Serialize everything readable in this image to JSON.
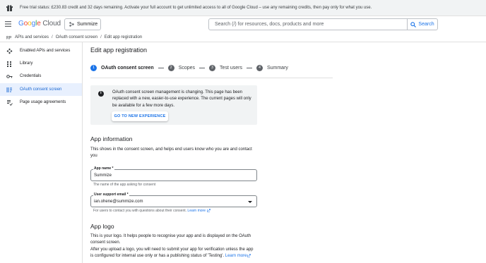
{
  "banner": {
    "text": "Free trial status: £230.83 credit and 32 days remaining. Activate your full account to get unlimited access to all of Google Cloud – use any remaining credits, then pay only for what you use."
  },
  "header": {
    "logo_google": "Google",
    "logo_cloud": "Cloud",
    "project": "Summize",
    "search_placeholder": "Search (/) for resources, docs, products and more",
    "search_button": "Search"
  },
  "breadcrumb": [
    "APIs and services",
    "OAuth consent screen",
    "Edit app registration"
  ],
  "sidebar": {
    "items": [
      {
        "label": "Enabled APIs and services",
        "icon": "apis-icon",
        "active": false
      },
      {
        "label": "Library",
        "icon": "library-icon",
        "active": false
      },
      {
        "label": "Credentials",
        "icon": "key-icon",
        "active": false
      },
      {
        "label": "OAuth consent screen",
        "icon": "consent-icon",
        "active": true
      },
      {
        "label": "Page usage agreements",
        "icon": "agreements-icon",
        "active": false
      }
    ]
  },
  "main": {
    "title": "Edit app registration",
    "steps": [
      {
        "num": "1",
        "label": "OAuth consent screen",
        "active": true
      },
      {
        "num": "2",
        "label": "Scopes",
        "active": false
      },
      {
        "num": "3",
        "label": "Test users",
        "active": false
      },
      {
        "num": "4",
        "label": "Summary",
        "active": false
      }
    ],
    "notice": {
      "line1": "OAuth consent screen management is changing. This page has been",
      "line2": "replaced with a new, easier-to-use experience. The current pages will only",
      "line3": "be available for a few more days.",
      "button": "GO TO NEW EXPERIENCE"
    },
    "app_info": {
      "heading": "App information",
      "desc_line1": "This shows in the consent screen, and helps end users know who you are and contact",
      "desc_line2": "you",
      "app_name_label": "App name *",
      "app_name_value": "Summize",
      "app_name_hint": "The name of the app asking for consent",
      "support_email_label": "User support email *",
      "support_email_value": "ian.ohene@summize.com",
      "support_email_hint": "For users to contact you with questions about their consent.",
      "learn_more": "Learn more"
    },
    "app_logo": {
      "heading": "App logo",
      "line1": "This is your logo. It helps people to recognise your app and is displayed on the OAuth",
      "line2": "consent screen.",
      "line3": "After you upload a logo, you will need to submit your app for verification unless the app",
      "line4": "is configured for internal use only or has a publishing status of 'Testing'.",
      "learn_more": "Learn more"
    }
  }
}
